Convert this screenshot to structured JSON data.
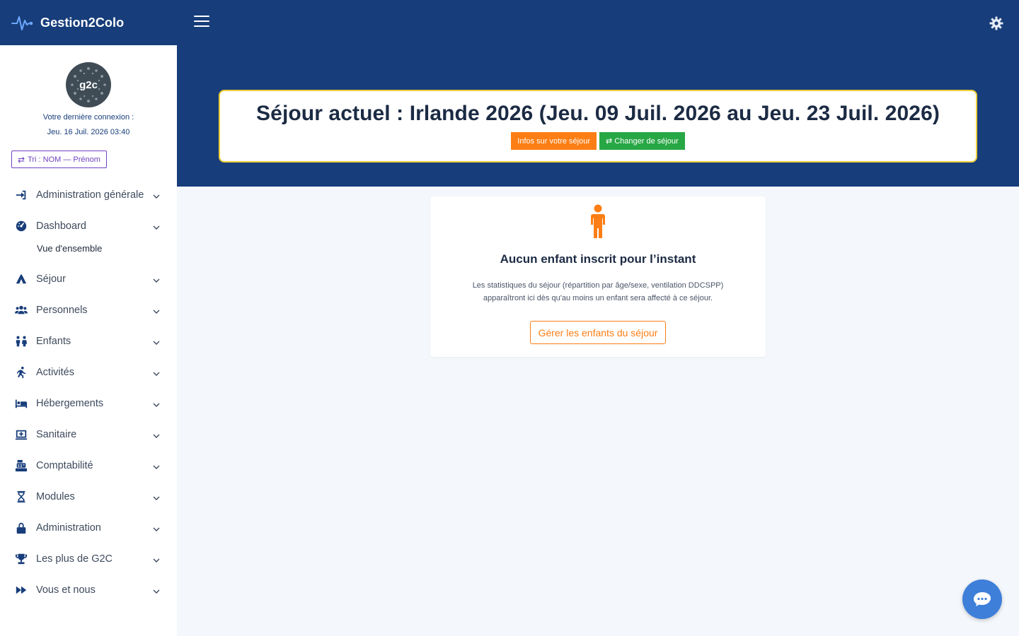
{
  "brand": {
    "name": "Gestion2Colo"
  },
  "profile": {
    "avatar_text": "g2c",
    "last_connection_label": "Votre dernière connexion :",
    "last_connection_date": "Jeu. 16 Juil. 2026 03:40"
  },
  "sort_button": {
    "label": "Tri : NOM — Prénom"
  },
  "nav": {
    "items": [
      {
        "label": "Administration générale",
        "icon": "sign-in-icon"
      },
      {
        "label": "Dashboard",
        "icon": "dashboard-icon"
      },
      {
        "label": "Séjour",
        "icon": "campground-icon"
      },
      {
        "label": "Personnels",
        "icon": "users-icon"
      },
      {
        "label": "Enfants",
        "icon": "children-icon"
      },
      {
        "label": "Activités",
        "icon": "running-icon"
      },
      {
        "label": "Hébergements",
        "icon": "bed-icon"
      },
      {
        "label": "Sanitaire",
        "icon": "medical-icon"
      },
      {
        "label": "Comptabilité",
        "icon": "cash-register-icon"
      },
      {
        "label": "Modules",
        "icon": "hourglass-icon"
      },
      {
        "label": "Administration",
        "icon": "lock-icon"
      },
      {
        "label": "Les plus de G2C",
        "icon": "trophy-icon"
      },
      {
        "label": "Vous et nous",
        "icon": "forward-icon"
      }
    ],
    "dashboard_sub": "Vue d'ensemble"
  },
  "sejour": {
    "title": "Séjour actuel : Irlande 2026 (Jeu. 09 Juil. 2026 au Jeu. 23 Juil. 2026)",
    "info_button": "Infos sur votre séjour",
    "change_button": "Changer de séjour"
  },
  "card": {
    "title": "Aucun enfant inscrit pour l’instant",
    "desc_line1": "Les statistiques du séjour (répartition par âge/sexe, ventilation DDCSPP)",
    "desc_line2": "apparaîtront ici dès qu'au moins un enfant sera affecté à ce séjour.",
    "button": "Gérer les enfants du séjour"
  },
  "colors": {
    "primary": "#173d7a",
    "accent_orange": "#fd7e14",
    "accent_green": "#28a745",
    "highlight_border": "#f0cf3a",
    "sort_purple": "#6f42c1",
    "chat_blue": "#3d7fd9"
  }
}
